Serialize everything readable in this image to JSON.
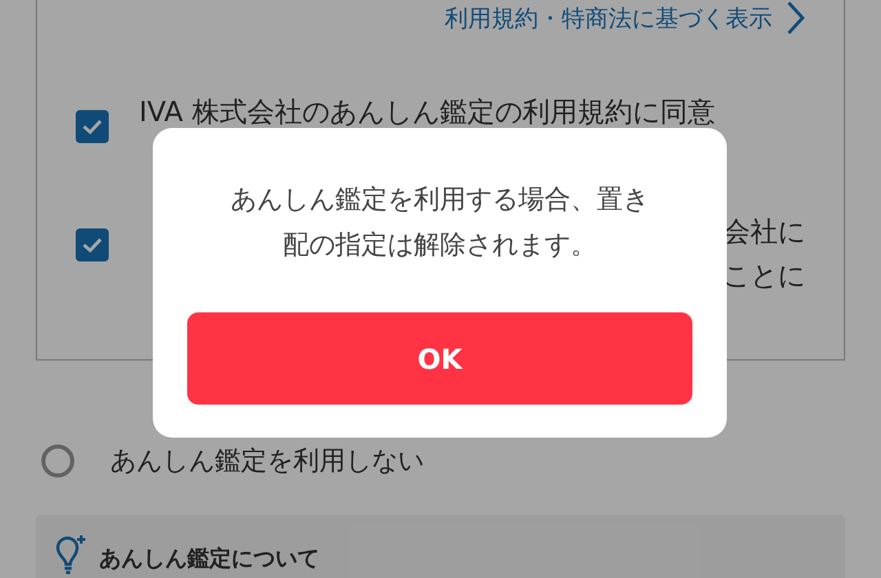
{
  "terms_link": {
    "label": "利用規約・特商法に基づく表示"
  },
  "consents": [
    {
      "lines": [
        "IVA 株式会社のあんしん鑑定の利用規約に同意"
      ],
      "checked": true
    },
    {
      "lines": [
        "会社に",
        "ことに"
      ],
      "checked": true
    }
  ],
  "radio_option": {
    "label": "あんしん鑑定を利用しない",
    "selected": false
  },
  "info_panel": {
    "title": "あんしん鑑定について"
  },
  "dialog": {
    "message": "あんしん鑑定を利用する場合、置き配の指定は解除されます。",
    "button": "OK"
  }
}
